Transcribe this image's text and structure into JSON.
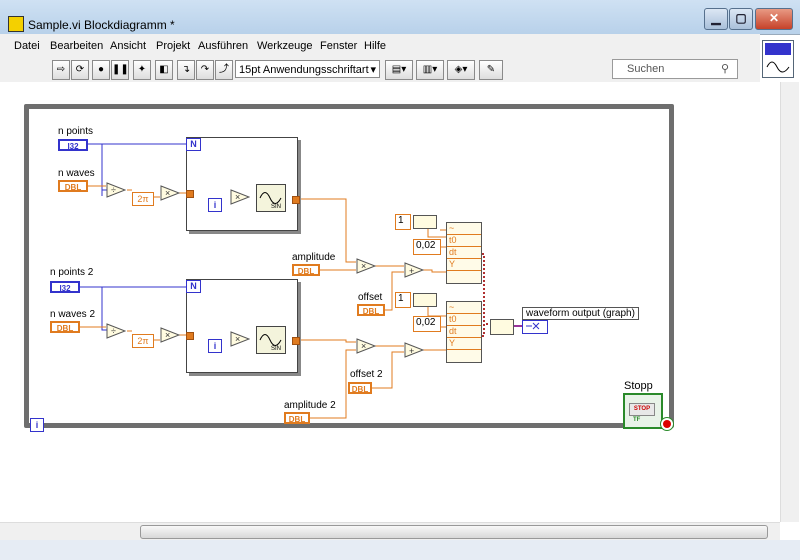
{
  "window": {
    "title": "Sample.vi Blockdiagramm *",
    "minimize": "▁",
    "maximize": "▢",
    "close": "✕"
  },
  "menu": [
    "Datei",
    "Bearbeiten",
    "Ansicht",
    "Projekt",
    "Ausführen",
    "Werkzeuge",
    "Fenster",
    "Hilfe"
  ],
  "toolbar": {
    "font": "15pt Anwendungsschriftart",
    "search_placeholder": "Suchen"
  },
  "diagram": {
    "controls": {
      "n_points": {
        "label": "n points",
        "type": "I32"
      },
      "n_waves": {
        "label": "n waves",
        "type": "DBL"
      },
      "n_points_2": {
        "label": "n points 2",
        "type": "I32"
      },
      "n_waves_2": {
        "label": "n waves 2",
        "type": "DBL"
      },
      "amplitude": {
        "label": "amplitude",
        "type": "DBL"
      },
      "offset": {
        "label": "offset",
        "type": "DBL"
      },
      "offset_2": {
        "label": "offset 2",
        "type": "DBL"
      },
      "amplitude_2": {
        "label": "amplitude 2",
        "type": "DBL"
      }
    },
    "constants": {
      "two_pi": "2π",
      "t0_1": "1",
      "dt_1": "0,02",
      "t0_2": "1",
      "dt_2": "0,02"
    },
    "loop_terminals": {
      "n": "N",
      "i": "i"
    },
    "bundle_labels": [
      "~",
      "t0",
      "dt",
      "Y"
    ],
    "indicator": {
      "label": "waveform output (graph)"
    },
    "stop": {
      "label": "Stopp",
      "button": "STOP",
      "tf": "TF"
    },
    "sine_label": "SIN"
  },
  "colors": {
    "integer": "#3333cc",
    "double": "#e07b1f",
    "boolean": "#2a8a2a",
    "loop_border": "#6e6e6e"
  }
}
